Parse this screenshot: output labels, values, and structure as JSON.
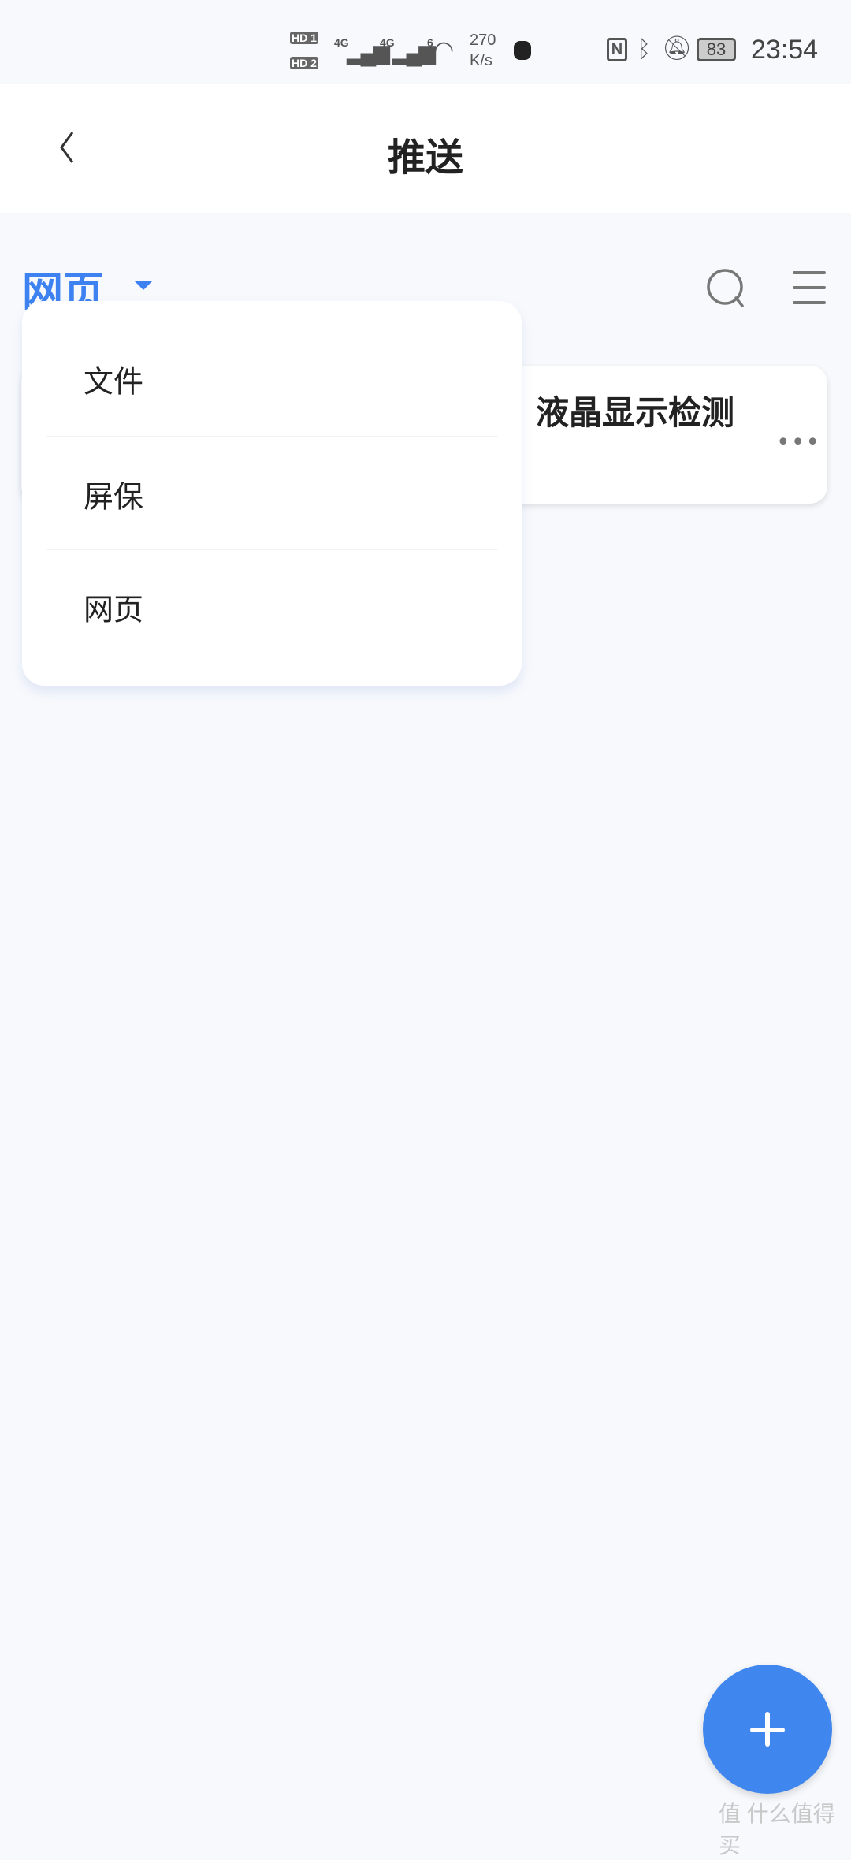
{
  "status_bar": {
    "sim1": "HD 1",
    "sim2": "HD 2",
    "net1": "4G",
    "net2": "4G",
    "wifi": "6",
    "speed_value": "270",
    "speed_unit": "K/s",
    "battery": "83",
    "time": "23:54"
  },
  "header": {
    "title": "推送",
    "back_icon": "chevron-left-icon"
  },
  "toolbar": {
    "selected_type": "网页",
    "search_icon": "search-icon",
    "menu_icon": "menu-icon"
  },
  "dropdown": {
    "items": [
      {
        "label": "文件"
      },
      {
        "label": "屏保"
      },
      {
        "label": "网页"
      }
    ]
  },
  "card": {
    "title_visible": "液晶显示检测",
    "more_icon": "more-horizontal-icon"
  },
  "fab": {
    "icon": "plus-icon"
  },
  "watermark": "值 什么值得买",
  "colors": {
    "accent": "#3d82f0",
    "fab": "#3f86ee",
    "background": "#f7f9fc"
  }
}
